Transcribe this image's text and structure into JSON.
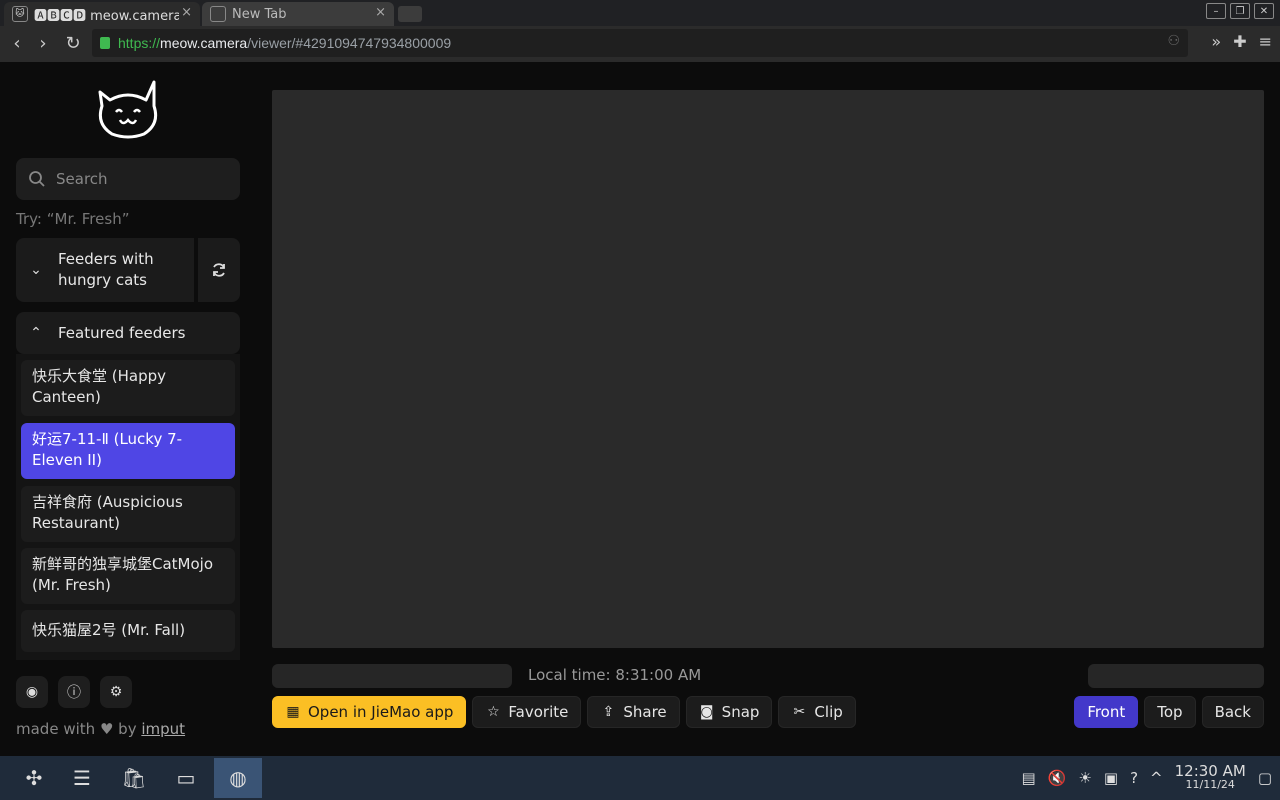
{
  "browser": {
    "tabs": [
      {
        "title": "🅰🅱🅲🅳 meow.camera",
        "close": "×"
      },
      {
        "title": "New Tab",
        "close": "×"
      }
    ],
    "url": {
      "scheme": "https://",
      "host": "meow.camera",
      "path": "/viewer/#4291094747934800009"
    },
    "window_buttons": [
      "–",
      "❐",
      "✕"
    ]
  },
  "sidebar": {
    "search_placeholder": "Search",
    "hint": "Try: “Mr. Fresh”",
    "groups": {
      "hungry": "Feeders with hungry cats",
      "featured": "Featured feeders"
    },
    "feeders": [
      {
        "label": "快乐大食堂 (Happy Canteen)"
      },
      {
        "label": "好运7-11-Ⅱ (Lucky 7-Eleven II)"
      },
      {
        "label": "吉祥食府 (Auspicious Restaurant)"
      },
      {
        "label": "新鲜哥的独享城堡CatMojo (Mr. Fresh)"
      },
      {
        "label": "快乐猫屋2号 (Mr. Fall)"
      }
    ],
    "made_with": "made with",
    "by": "by",
    "author": "imput"
  },
  "viewer": {
    "local_time": "Local time: 8:31:00 AM",
    "actions": [
      {
        "label": "Open in JieMao app",
        "icon": "qr-icon"
      },
      {
        "label": "Favorite",
        "icon": "star-icon"
      },
      {
        "label": "Share",
        "icon": "share-icon"
      },
      {
        "label": "Snap",
        "icon": "camera-icon"
      },
      {
        "label": "Clip",
        "icon": "scissors-icon"
      }
    ],
    "views": [
      {
        "label": "Front",
        "active": true
      },
      {
        "label": "Top",
        "active": false
      },
      {
        "label": "Back",
        "active": false
      }
    ]
  },
  "taskbar": {
    "time": "12:30 AM",
    "date": "11/11/24"
  },
  "colors": {
    "accent": "#4f46e5",
    "primary_button": "#fbbf24",
    "active_view": "#4338ca"
  }
}
